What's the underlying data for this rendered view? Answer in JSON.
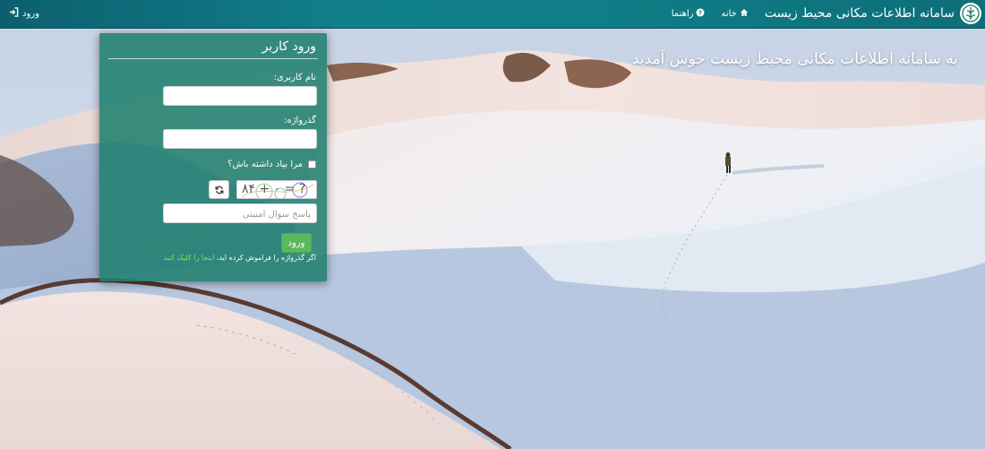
{
  "navbar": {
    "brand_title": "سامانه اطلاعات مکانی محیط زیست",
    "home_label": "خانه",
    "help_label": "راهنما",
    "login_label": "ورود"
  },
  "hero": {
    "welcome_text": "به سامانه اطلاعات مکانی محیط زیست خوش آمدید"
  },
  "login_form": {
    "title": "ورود کاربر",
    "username_label": "نام کاربری:",
    "username_value": "",
    "password_label": "گذرواژه:",
    "password_value": "",
    "remember_label": "مرا بیاد داشته باش؟",
    "captcha_text": "۸۴ + ۰ = ?",
    "captcha_placeholder": "پاسخ سوال امنیتی",
    "captcha_value": "",
    "submit_label": "ورود",
    "forgot_text": "اگر گذرواژه را فراموش کرده اید،",
    "forgot_link": "اینجا را کلیک کنید"
  },
  "colors": {
    "navbar": "#11808a",
    "panel": "#208070",
    "submit": "#5cb85c",
    "link": "#66ee55"
  },
  "icons": [
    "login-icon",
    "home-icon",
    "help-icon",
    "refresh-icon",
    "env-logo-icon"
  ]
}
